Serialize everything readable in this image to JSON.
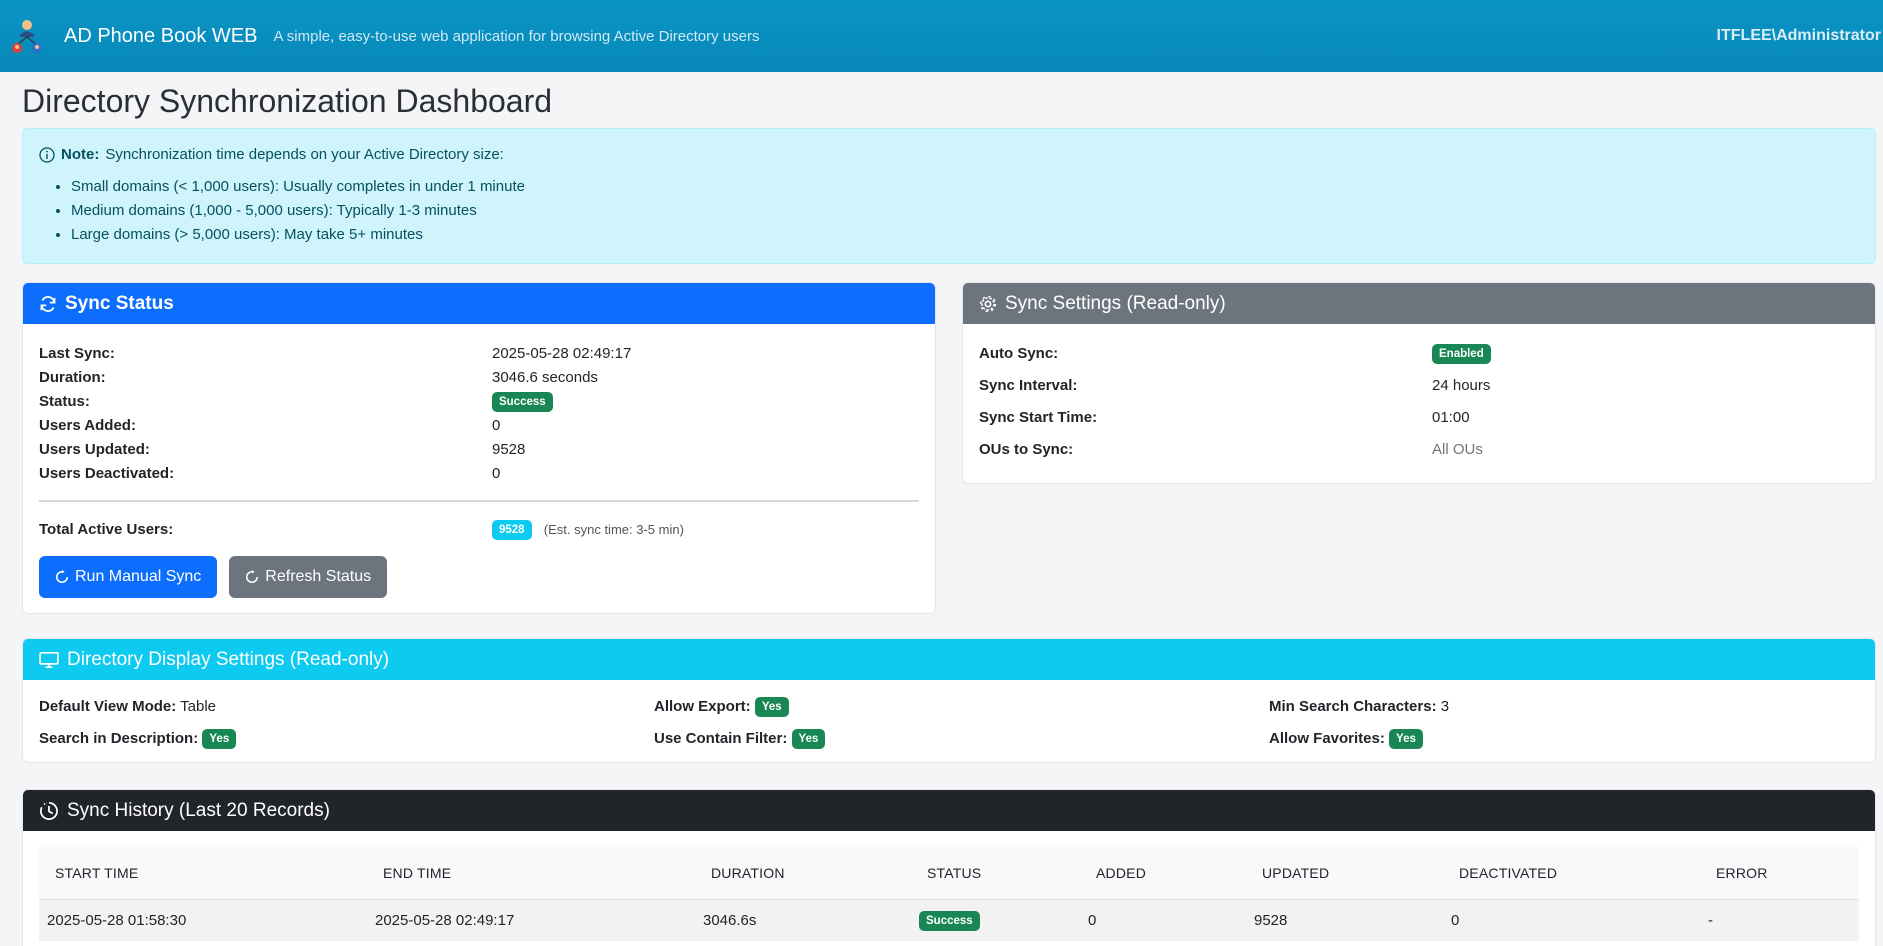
{
  "header": {
    "brand": "AD Phone Book WEB",
    "tagline": "A simple, easy-to-use web application for browsing Active Directory users",
    "user": "ITFLEE\\Administrator"
  },
  "page_title": "Directory Synchronization Dashboard",
  "note": {
    "label": "Note:",
    "text": "Synchronization time depends on your Active Directory size:",
    "items": [
      "Small domains (< 1,000 users): Usually completes in under 1 minute",
      "Medium domains (1,000 - 5,000 users): Typically 1-3 minutes",
      "Large domains (> 5,000 users): May take 5+ minutes"
    ]
  },
  "sync_status": {
    "title": "Sync Status",
    "rows": [
      {
        "label": "Last Sync:",
        "value": "2025-05-28 02:49:17"
      },
      {
        "label": "Duration:",
        "value": "3046.6 seconds"
      },
      {
        "label": "Status:",
        "value": "Success"
      },
      {
        "label": "Users Added:",
        "value": "0"
      },
      {
        "label": "Users Updated:",
        "value": "9528"
      },
      {
        "label": "Users Deactivated:",
        "value": "0"
      }
    ],
    "total_label": "Total Active Users:",
    "total_value": "9528",
    "est_text": "(Est. sync time: 3-5 min)",
    "run_button": "Run Manual Sync",
    "refresh_button": "Refresh Status"
  },
  "sync_settings": {
    "title": "Sync Settings (Read-only)",
    "rows": [
      {
        "label": "Auto Sync:",
        "value": "Enabled"
      },
      {
        "label": "Sync Interval:",
        "value": "24 hours"
      },
      {
        "label": "Sync Start Time:",
        "value": "01:00"
      },
      {
        "label": "OUs to Sync:",
        "value": "All OUs"
      }
    ]
  },
  "display_settings": {
    "title": "Directory Display Settings (Read-only)",
    "default_view_label": "Default View Mode:",
    "default_view_value": "Table",
    "allow_export_label": "Allow Export:",
    "allow_export_value": "Yes",
    "min_search_label": "Min Search Characters:",
    "min_search_value": "3",
    "search_desc_label": "Search in Description:",
    "search_desc_value": "Yes",
    "contain_filter_label": "Use Contain Filter:",
    "contain_filter_value": "Yes",
    "allow_fav_label": "Allow Favorites:",
    "allow_fav_value": "Yes"
  },
  "history": {
    "title": "Sync History (Last 20 Records)",
    "columns": [
      "START TIME",
      "END TIME",
      "DURATION",
      "STATUS",
      "ADDED",
      "UPDATED",
      "DEACTIVATED",
      "ERROR"
    ],
    "rows": [
      {
        "start": "2025-05-28 01:58:30",
        "end": "2025-05-28 02:49:17",
        "duration": "3046.6s",
        "status": "Success",
        "added": "0",
        "updated": "9528",
        "deactivated": "0",
        "error": "-"
      }
    ]
  },
  "colors": {
    "header_bg": "#0788b8",
    "primary": "#0d6efd",
    "secondary": "#6c757d",
    "info": "#0dcaf0",
    "success": "#198754",
    "dark": "#212529"
  },
  "icons": [
    "users-logo-icon",
    "info-icon",
    "refresh-icon",
    "gear-icon",
    "monitor-icon",
    "clock-history-icon"
  ]
}
